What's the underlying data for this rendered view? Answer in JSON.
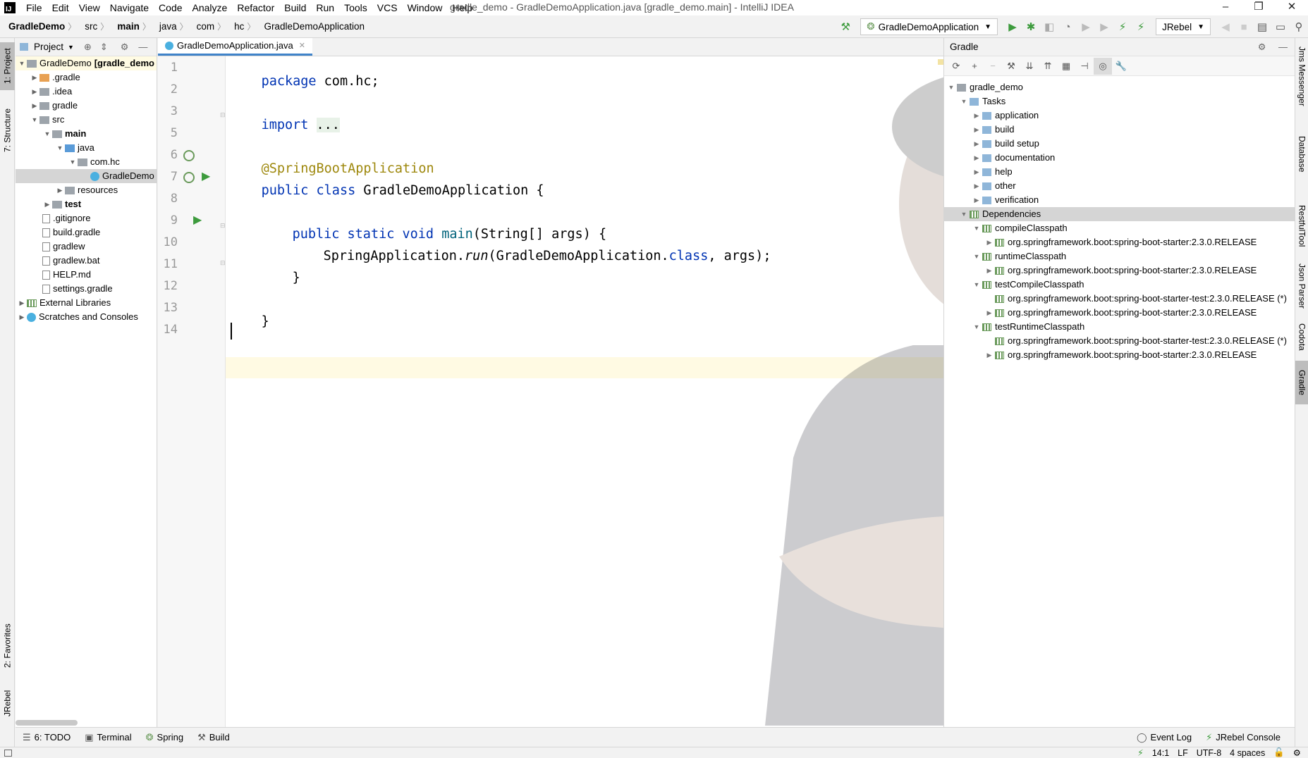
{
  "titlebar": {
    "menus": [
      "File",
      "Edit",
      "View",
      "Navigate",
      "Code",
      "Analyze",
      "Refactor",
      "Build",
      "Run",
      "Tools",
      "VCS",
      "Window",
      "Help"
    ],
    "window_title": "gradle_demo - GradleDemoApplication.java [gradle_demo.main] - IntelliJ IDEA",
    "minimize": "–",
    "maximize": "❐",
    "close": "✕"
  },
  "breadcrumbs": [
    "GradleDemo",
    "src",
    "main",
    "java",
    "com",
    "hc",
    "GradleDemoApplication"
  ],
  "toolbar": {
    "run_config": "GradleDemoApplication",
    "jrebel_config": "JRebel"
  },
  "left_stripe": {
    "project": "1: Project",
    "structure": "7: Structure",
    "favorites": "2: Favorites",
    "jrebel": "JRebel"
  },
  "right_stripe": {
    "jms": "Jms Messenger",
    "database": "Database",
    "restful": "RestfulTool",
    "json": "Json Parser",
    "codota": "Codota",
    "gradle": "Gradle"
  },
  "project_panel": {
    "title": "Project",
    "root_label": "GradleDemo",
    "root_suffix": "[gradle_demo",
    "items": [
      {
        "label": ".gradle"
      },
      {
        "label": ".idea"
      },
      {
        "label": "gradle"
      },
      {
        "label": "src"
      },
      {
        "label": "main"
      },
      {
        "label": "java"
      },
      {
        "label": "com.hc"
      },
      {
        "label": "GradleDemo"
      },
      {
        "label": "resources"
      },
      {
        "label": "test"
      },
      {
        "label": ".gitignore"
      },
      {
        "label": "build.gradle"
      },
      {
        "label": "gradlew"
      },
      {
        "label": "gradlew.bat"
      },
      {
        "label": "HELP.md"
      },
      {
        "label": "settings.gradle"
      },
      {
        "label": "External Libraries"
      },
      {
        "label": "Scratches and Consoles"
      }
    ]
  },
  "editor": {
    "tab": "GradleDemoApplication.java",
    "line_numbers": [
      "1",
      "2",
      "3",
      "5",
      "6",
      "7",
      "8",
      "9",
      "10",
      "11",
      "12",
      "13",
      "14"
    ],
    "tokens": {
      "package_kw": "package",
      "package_name": " com.hc;",
      "import_kw": "import",
      "import_fold": "...",
      "annotation": "@SpringBootApplication",
      "public_kw": "public",
      "class_kw": " class",
      "class_name": " GradleDemoApplication {",
      "public_kw2": "public",
      "static_kw": " static",
      "void_kw": " void",
      "main_fn": " main",
      "main_args": "(String[] args) {",
      "spring_app": "SpringApplication.",
      "run_mth": "run",
      "run_args": "(GradleDemoApplication.",
      "class_kw2": "class",
      "run_end": ", args);",
      "close_method": "}",
      "close_class": "}"
    }
  },
  "gradle_panel": {
    "title": "Gradle",
    "root": "gradle_demo",
    "tasks_label": "Tasks",
    "tasks": [
      "application",
      "build",
      "build setup",
      "documentation",
      "help",
      "other",
      "verification"
    ],
    "dependencies_label": "Dependencies",
    "compile_classpath": "compileClasspath",
    "dep_starter": "org.springframework.boot:spring-boot-starter:2.3.0.RELEASE",
    "runtime_classpath": "runtimeClasspath",
    "test_compile_classpath": "testCompileClasspath",
    "dep_starter_test": "org.springframework.boot:spring-boot-starter-test:2.3.0.RELEASE (*)",
    "test_runtime_classpath": "testRuntimeClasspath"
  },
  "bottom_tools": {
    "todo": "6: TODO",
    "terminal": "Terminal",
    "spring": "Spring",
    "build": "Build",
    "event_log": "Event Log",
    "jrebel_console": "JRebel Console"
  },
  "status": {
    "position": "14:1",
    "line_sep": "LF",
    "encoding": "UTF-8",
    "indent": "4 spaces"
  },
  "colors": {
    "keyword": "#0033b3",
    "annotation": "#9e880d",
    "method": "#00627a",
    "selection_tab": "#4083c9",
    "run_green": "#3d9b3d"
  }
}
